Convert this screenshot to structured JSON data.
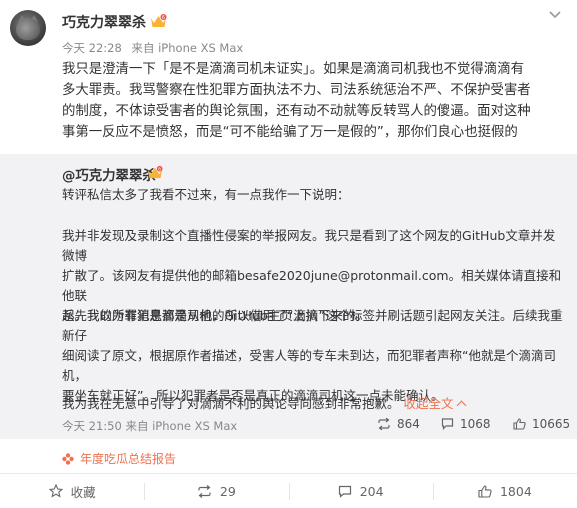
{
  "post": {
    "username": "巧克力翠翠杀",
    "time": "今天 22:28",
    "source": "来自 iPhone XS Max",
    "text_lines": [
      "我只是澄清一下「是不是滴滴司机未证实」。如果是滴滴司机我也不觉得滴滴有",
      "多大罪责。我骂警察在性犯罪方面执法不力、司法系统惩治不严、不保护受害者",
      "的制度，不体谅受害者的舆论氛围，还有动不动就等反转骂人的傻逼。面对这种",
      "事第一反应不是愤怒，而是“可不能给骗了万一是假的”，那你们良心也挺假的"
    ]
  },
  "repost": {
    "username": "@巧克力翠翠杀",
    "p1": "转评私信太多了我看不过来，有一点我作一下说明：",
    "p2_lines": [
      "我并非发现及录制这个直播性侵案的举报网友。我只是看到了这个网友的GitHub文章并发微博",
      "扩散了。该网友有提供他的邮箱besafe2020june@protonmail.com。相关媒体请直接和他联",
      "系。我的所有消息都是从他的GitHub主页上扒下来的。"
    ],
    "p3_lines": [
      "起先我以为罪犯是滴滴司机，所以借用了“滴滴”这个标签并刷话题引起网友关注。后续我重新仔",
      "细阅读了原文，根据原作者描述，受害人等的专车未到达，而犯罪者声称“他就是个滴滴司机，",
      "要坐车就正好”。所以犯罪者是否是真正的滴滴司机这一点未能确认。"
    ],
    "p4": "我为我在无意中引导了对滴滴不利的舆论导向感到非常抱歉。",
    "fold_label": "收起全文",
    "time": "今天 21:50",
    "source": "来自 iPhone XS Max",
    "reposts": "864",
    "comments": "1068",
    "likes": "10665"
  },
  "report_label": "年度吃瓜总结报告",
  "actions": {
    "favorite": "收藏",
    "repost": "29",
    "comment": "204",
    "like": "1804"
  },
  "colors": {
    "accent": "#eb7350",
    "quote_bg": "#f2f2f5",
    "muted": "#888888"
  }
}
